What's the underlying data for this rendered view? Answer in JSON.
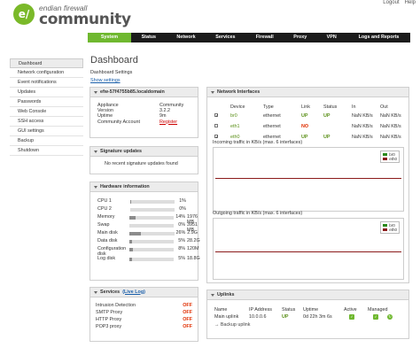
{
  "header": {
    "logo_mark": "e/",
    "logo_small": "endian firewall",
    "logo_big": "community",
    "links": [
      "Logout",
      "Help",
      ""
    ]
  },
  "nav": {
    "tabs": [
      "System",
      "Status",
      "Network",
      "Services",
      "Firewall",
      "Proxy",
      "VPN",
      "Logs and Reports"
    ],
    "active": "System"
  },
  "sidebar": {
    "items": [
      "Dashboard",
      "Network configuration",
      "Event notifications",
      "Updates",
      "Passwords",
      "Web Console",
      "SSH access",
      "GUI settings",
      "Backup",
      "Shutdown"
    ]
  },
  "main": {
    "title": "Dashboard",
    "subtitle": "Dashboard Settings",
    "show_settings": "Show settings"
  },
  "host_panel": {
    "title": "efw-57f4755b85.localdomain",
    "rows": [
      {
        "label": "Appliance",
        "value": "Community"
      },
      {
        "label": "Version",
        "value": "3.2.2"
      },
      {
        "label": "Uptime",
        "value": "9m"
      },
      {
        "label": "Community Account",
        "value": "Register"
      }
    ]
  },
  "signature_panel": {
    "title": "Signature updates",
    "message": "No recent signature updates found"
  },
  "hardware_panel": {
    "title": "Hardware information",
    "rows": [
      {
        "label": "CPU 1",
        "percent": 1,
        "percent_text": "1%",
        "extra": ""
      },
      {
        "label": "CPU 2",
        "percent": 0,
        "percent_text": "0%",
        "extra": ""
      },
      {
        "label": "Memory",
        "percent": 14,
        "percent_text": "14%",
        "extra": "1976 MB"
      },
      {
        "label": "Swap",
        "percent": 0,
        "percent_text": "0%",
        "extra": "3951 MB"
      },
      {
        "label": "Main disk",
        "percent": 26,
        "percent_text": "26%",
        "extra": "2.9G"
      },
      {
        "label": "Data disk",
        "percent": 5,
        "percent_text": "5%",
        "extra": "28.2G"
      },
      {
        "label": "Configuration disk",
        "percent": 8,
        "percent_text": "8%",
        "extra": "120M"
      },
      {
        "label": "Log disk",
        "percent": 5,
        "percent_text": "5%",
        "extra": "18.8G"
      }
    ]
  },
  "services_panel": {
    "title": "Services",
    "live_log": "(Live Log)",
    "rows": [
      {
        "label": "Intrusion Detection",
        "status": "OFF"
      },
      {
        "label": "SMTP Proxy",
        "status": "OFF"
      },
      {
        "label": "HTTP Proxy",
        "status": "OFF"
      },
      {
        "label": "POP3 proxy",
        "status": "OFF"
      }
    ]
  },
  "interfaces_panel": {
    "title": "Network Interfaces",
    "headers": [
      "Device",
      "Type",
      "Link",
      "Status",
      "In",
      "Out"
    ],
    "rows": [
      {
        "checked": true,
        "device": "br0",
        "type": "ethernet",
        "link": "UP",
        "status": "UP",
        "in": "NaN KB/s",
        "out": "NaN KB/s"
      },
      {
        "checked": false,
        "device": "eth1",
        "type": "ethernet",
        "link": "NO",
        "status": "",
        "in": "NaN KB/s",
        "out": "NaN KB/s"
      },
      {
        "checked": true,
        "device": "eth0",
        "type": "ethernet",
        "link": "UP",
        "status": "UP",
        "in": "NaN KB/s",
        "out": "NaN KB/s"
      }
    ],
    "incoming_title": "Incoming traffic in KB/s (max. 6 interfaces)",
    "outgoing_title": "Outgoing traffic in KB/s (max. 6 interfaces)",
    "legend": [
      {
        "name": "br0",
        "color": "#2a8a1a"
      },
      {
        "name": "eth0",
        "color": "#8b1a1a"
      }
    ]
  },
  "uplinks_panel": {
    "title": "Uplinks",
    "headers": [
      "Name",
      "IP Address",
      "Status",
      "Uptime",
      "Active",
      "Managed"
    ],
    "rows": [
      {
        "name": "Main uplink",
        "ip": "10.0.0.6",
        "status": "UP",
        "uptime": "0d 22h 3m 6s"
      }
    ],
    "backup_uplink": "→ Backup uplink"
  },
  "colors": {
    "accent": "#6fb82f",
    "nav_bg": "#1b1b1b",
    "off": "#e02e00",
    "link": "#1a5faa"
  }
}
